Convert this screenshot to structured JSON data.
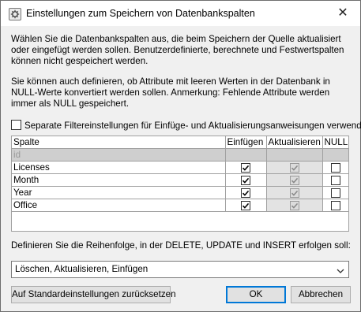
{
  "window": {
    "title": "Einstellungen zum Speichern von Datenbankspalten",
    "close_glyph": "✕"
  },
  "intro": {
    "p1": "Wählen Sie die Datenbankspalten aus, die beim Speichern der Quelle aktualisiert oder eingefügt werden sollen. Benutzerdefinierte, berechnete und Festwertspalten können nicht gespeichert werden.",
    "p2": "Sie können auch definieren, ob Attribute mit leeren Werten in der Datenbank in NULL-Werte konvertiert werden sollen. Anmerkung: Fehlende Attribute werden immer als NULL gespeichert."
  },
  "separate_filter": {
    "label": "Separate Filtereinstellungen für Einfüge- und Aktualisierungsanweisungen verwenden",
    "checked": false
  },
  "grid": {
    "headers": [
      "Spalte",
      "Einfügen",
      "Aktualisieren",
      "NULL"
    ],
    "rows": [
      {
        "name": "id",
        "disabled": true,
        "insert": false,
        "update": false,
        "null": false
      },
      {
        "name": "Licenses",
        "disabled": false,
        "insert": true,
        "update": true,
        "null": false
      },
      {
        "name": "Month",
        "disabled": false,
        "insert": true,
        "update": true,
        "null": false
      },
      {
        "name": "Year",
        "disabled": false,
        "insert": true,
        "update": true,
        "null": false
      },
      {
        "name": "Office",
        "disabled": false,
        "insert": true,
        "update": true,
        "null": false
      }
    ]
  },
  "order": {
    "label": "Definieren Sie die Reihenfolge, in der DELETE, UPDATE und INSERT erfolgen soll:",
    "selected": "Löschen, Aktualisieren, Einfügen"
  },
  "buttons": {
    "reset": "Auf Standardeinstellungen zurücksetzen",
    "ok": "OK",
    "cancel": "Abbrechen"
  },
  "icons": {
    "title": "database-settings-icon",
    "close": "close-icon",
    "dropdown": "chevron-down-icon",
    "check": "checkmark-icon"
  }
}
